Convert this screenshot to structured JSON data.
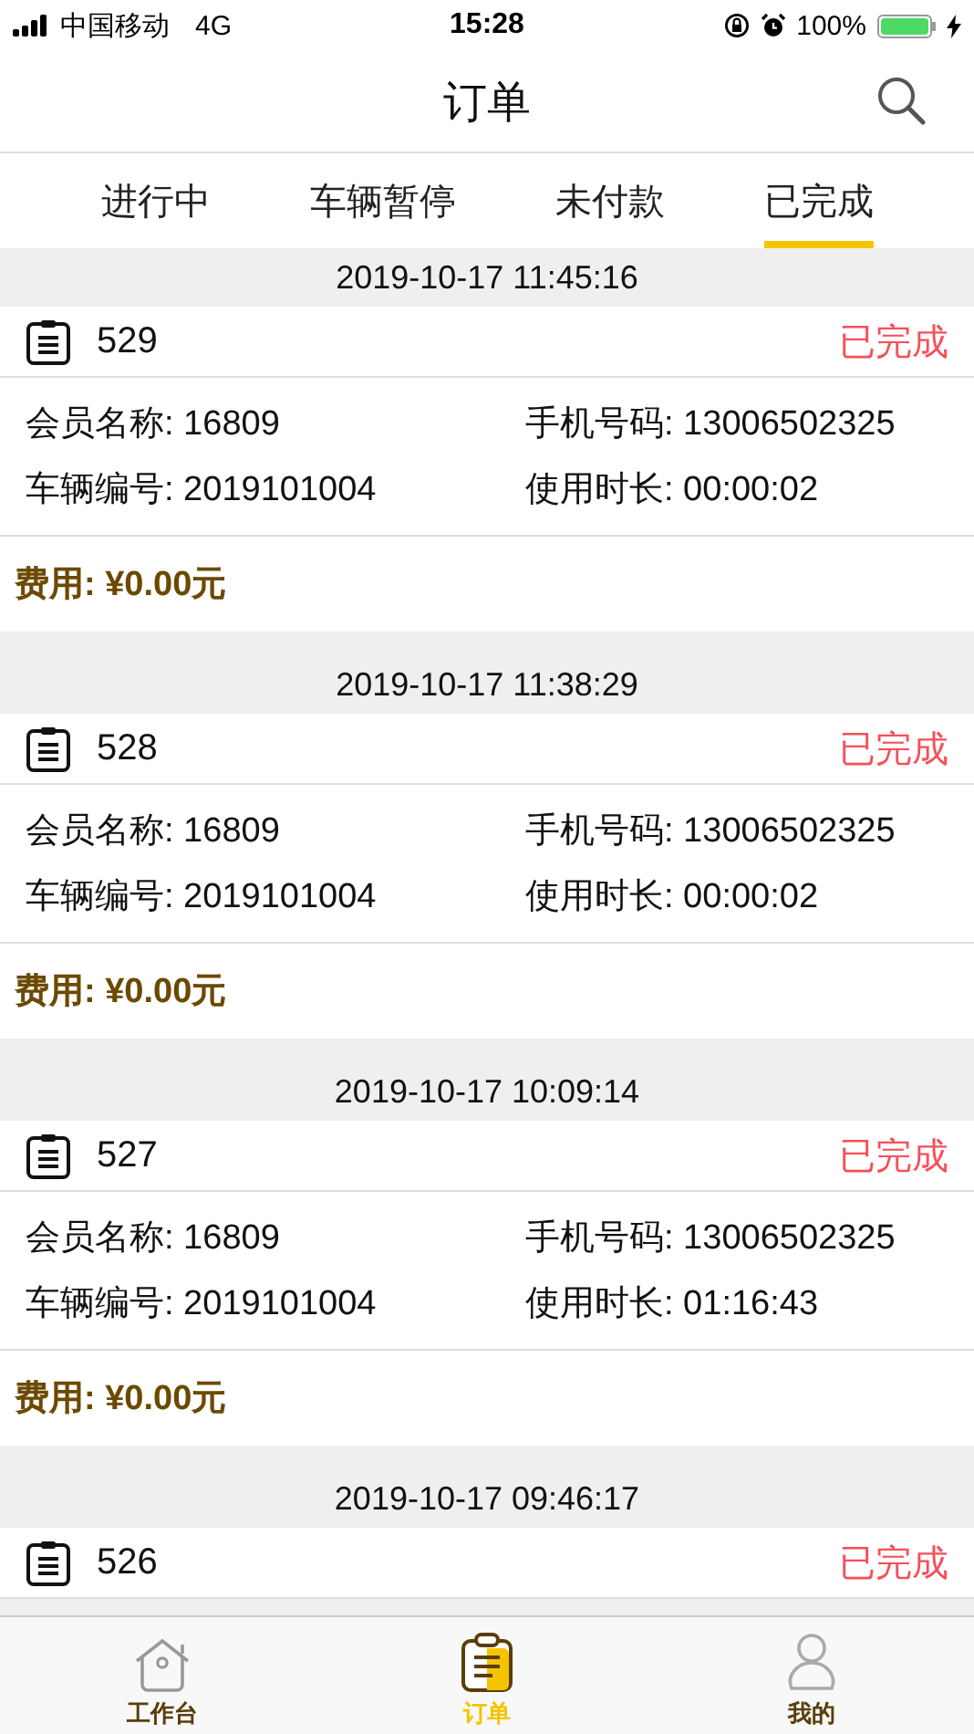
{
  "status_bar": {
    "carrier": "中国移动",
    "network": "4G",
    "time": "15:28",
    "battery": "100%"
  },
  "nav": {
    "title": "订单"
  },
  "tabs": [
    {
      "label": "进行中",
      "selected": false
    },
    {
      "label": "车辆暂停",
      "selected": false
    },
    {
      "label": "未付款",
      "selected": false
    },
    {
      "label": "已完成",
      "selected": true
    }
  ],
  "orders": [
    {
      "date": "2019-10-17 11:45:16",
      "id": "529",
      "status": "已完成",
      "member": "会员名称: 16809",
      "phone": "手机号码: 13006502325",
      "vehicle": "车辆编号: 2019101004",
      "duration": "使用时长: 00:00:02",
      "fee": "费用: ¥0.00元"
    },
    {
      "date": "2019-10-17 11:38:29",
      "id": "528",
      "status": "已完成",
      "member": "会员名称: 16809",
      "phone": "手机号码: 13006502325",
      "vehicle": "车辆编号: 2019101004",
      "duration": "使用时长: 00:00:02",
      "fee": "费用: ¥0.00元"
    },
    {
      "date": "2019-10-17 10:09:14",
      "id": "527",
      "status": "已完成",
      "member": "会员名称: 16809",
      "phone": "手机号码: 13006502325",
      "vehicle": "车辆编号: 2019101004",
      "duration": "使用时长: 01:16:43",
      "fee": "费用: ¥0.00元"
    },
    {
      "date": "2019-10-17 09:46:17",
      "id": "526",
      "status": "已完成"
    }
  ],
  "tab_bar": [
    {
      "label": "工作台",
      "kind": "home",
      "selected": false
    },
    {
      "label": "订单",
      "kind": "orders",
      "selected": true
    },
    {
      "label": "我的",
      "kind": "profile",
      "selected": false
    }
  ]
}
